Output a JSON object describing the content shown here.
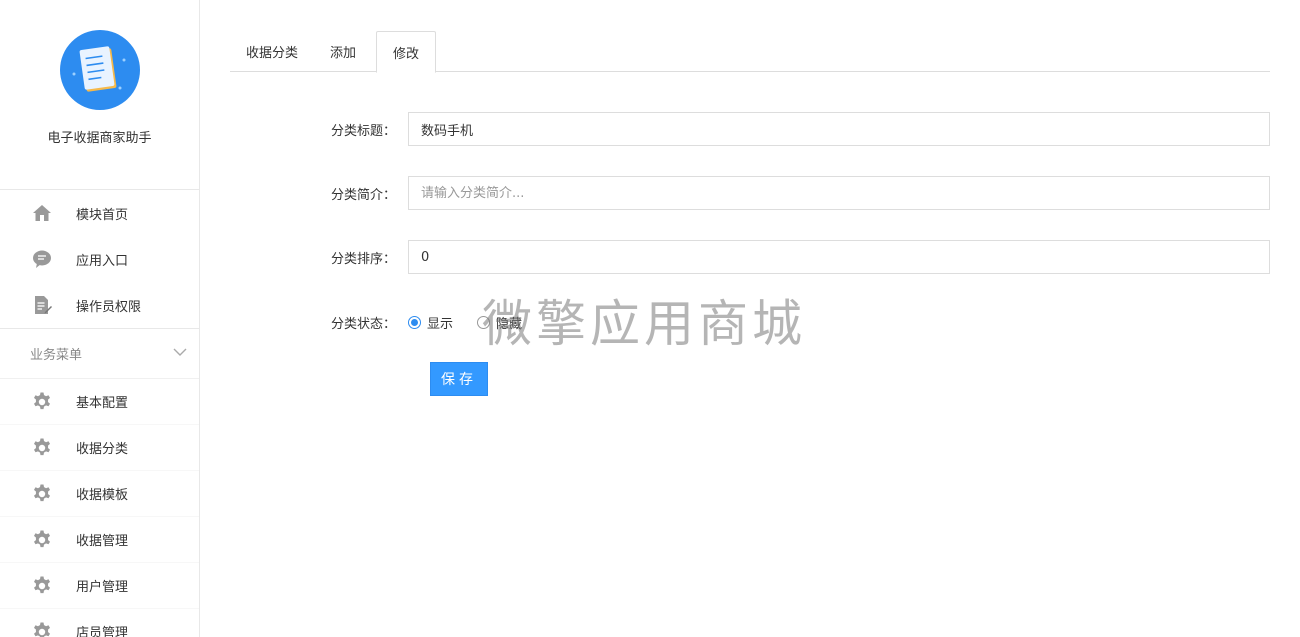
{
  "brand": {
    "name": "电子收据商家助手"
  },
  "nav_top": [
    {
      "label": "模块首页",
      "icon": "home-icon"
    },
    {
      "label": "应用入口",
      "icon": "chat-icon"
    },
    {
      "label": "操作员权限",
      "icon": "edit-doc-icon"
    }
  ],
  "group": {
    "title": "业务菜单",
    "items": [
      {
        "label": "基本配置",
        "icon": "gear-icon"
      },
      {
        "label": "收据分类",
        "icon": "gear-icon"
      },
      {
        "label": "收据模板",
        "icon": "gear-icon"
      },
      {
        "label": "收据管理",
        "icon": "gear-icon"
      },
      {
        "label": "用户管理",
        "icon": "gear-icon"
      },
      {
        "label": "店员管理",
        "icon": "gear-icon"
      }
    ]
  },
  "tabs": [
    {
      "label": "收据分类"
    },
    {
      "label": "添加"
    },
    {
      "label": "修改",
      "active": true
    }
  ],
  "form": {
    "title_label": "分类标题：",
    "title_value": "数码手机",
    "intro_label": "分类简介：",
    "intro_placeholder": "请输入分类简介...",
    "sort_label": "分类排序：",
    "sort_value": "0",
    "status_label": "分类状态：",
    "status_options": [
      {
        "label": "显示",
        "selected": true
      },
      {
        "label": "隐藏",
        "selected": false
      }
    ],
    "save_label": "保存"
  },
  "watermark": "微擎应用商城",
  "colors": {
    "accent": "#2d8cf0",
    "button": "#3399ff"
  }
}
